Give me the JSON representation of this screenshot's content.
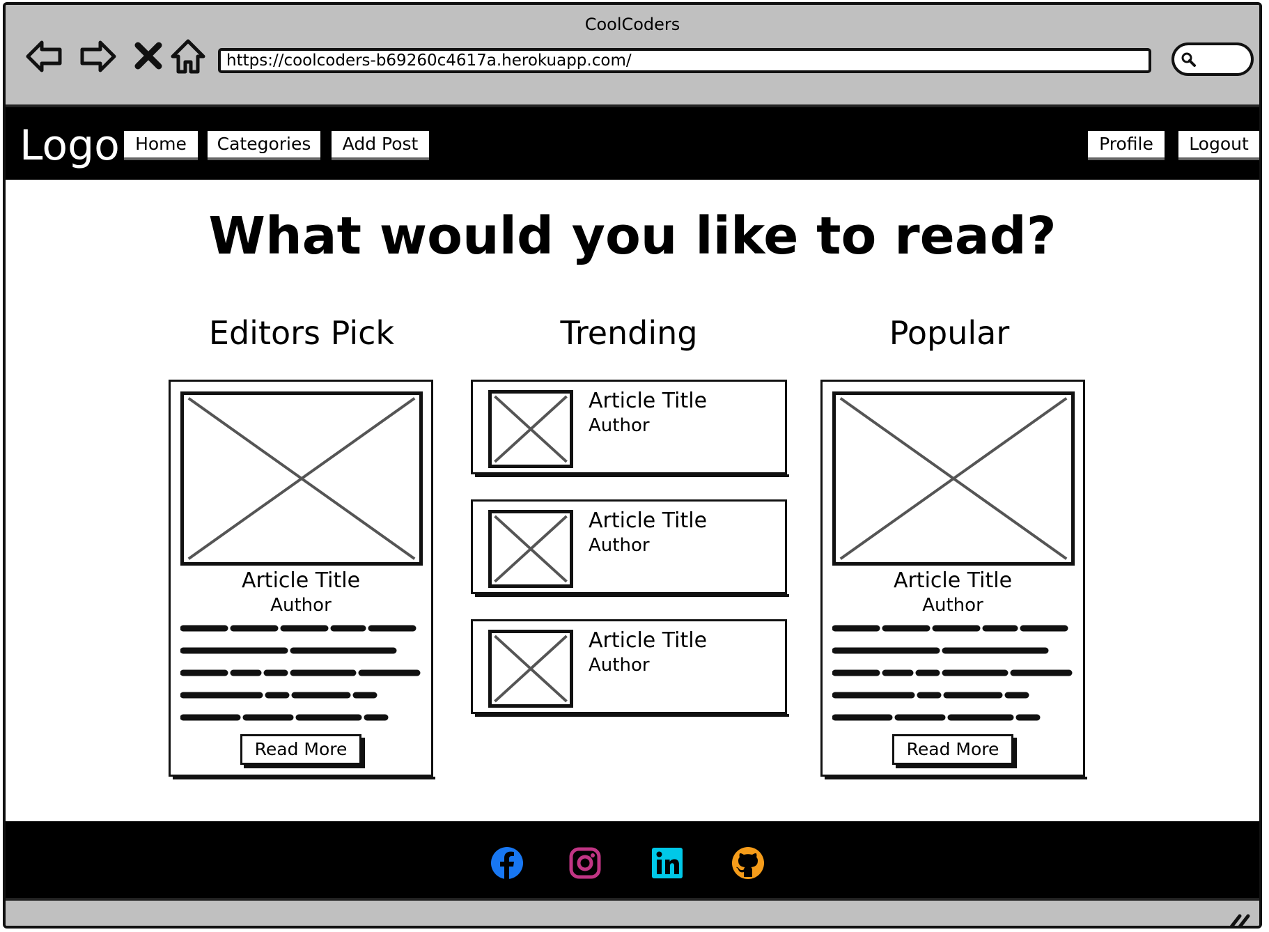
{
  "browser": {
    "title": "CoolCoders",
    "url": "https://coolcoders-b69260c4617a.herokuapp.com/",
    "icons": [
      "back-arrow-icon",
      "forward-arrow-icon",
      "stop-icon",
      "home-icon",
      "search-icon"
    ]
  },
  "nav": {
    "logo": "Logo",
    "home": "Home",
    "categories": "Categories",
    "add_post": "Add Post",
    "profile": "Profile",
    "logout": "Logout"
  },
  "main": {
    "heading": "What would you like to read?",
    "editors_pick": {
      "heading": "Editors Pick",
      "title": "Article Title",
      "author": "Author",
      "button": "Read More"
    },
    "trending": {
      "heading": "Trending",
      "items": [
        {
          "title": "Article Title",
          "author": "Author"
        },
        {
          "title": "Article Title",
          "author": "Author"
        },
        {
          "title": "Article Title",
          "author": "Author"
        }
      ]
    },
    "popular": {
      "heading": "Popular",
      "title": "Article Title",
      "author": "Author",
      "button": "Read More"
    }
  },
  "footer": {
    "social": [
      {
        "icon": "facebook-icon",
        "color": "#1877f2"
      },
      {
        "icon": "instagram-icon",
        "color": "#c13584"
      },
      {
        "icon": "linkedin-icon",
        "color": "#00c8e8"
      },
      {
        "icon": "github-icon",
        "color": "#f59c1a"
      }
    ]
  },
  "colors": {
    "chrome": "#c0c0c0",
    "nav_bg": "#000000",
    "footer_bg": "#000000"
  }
}
